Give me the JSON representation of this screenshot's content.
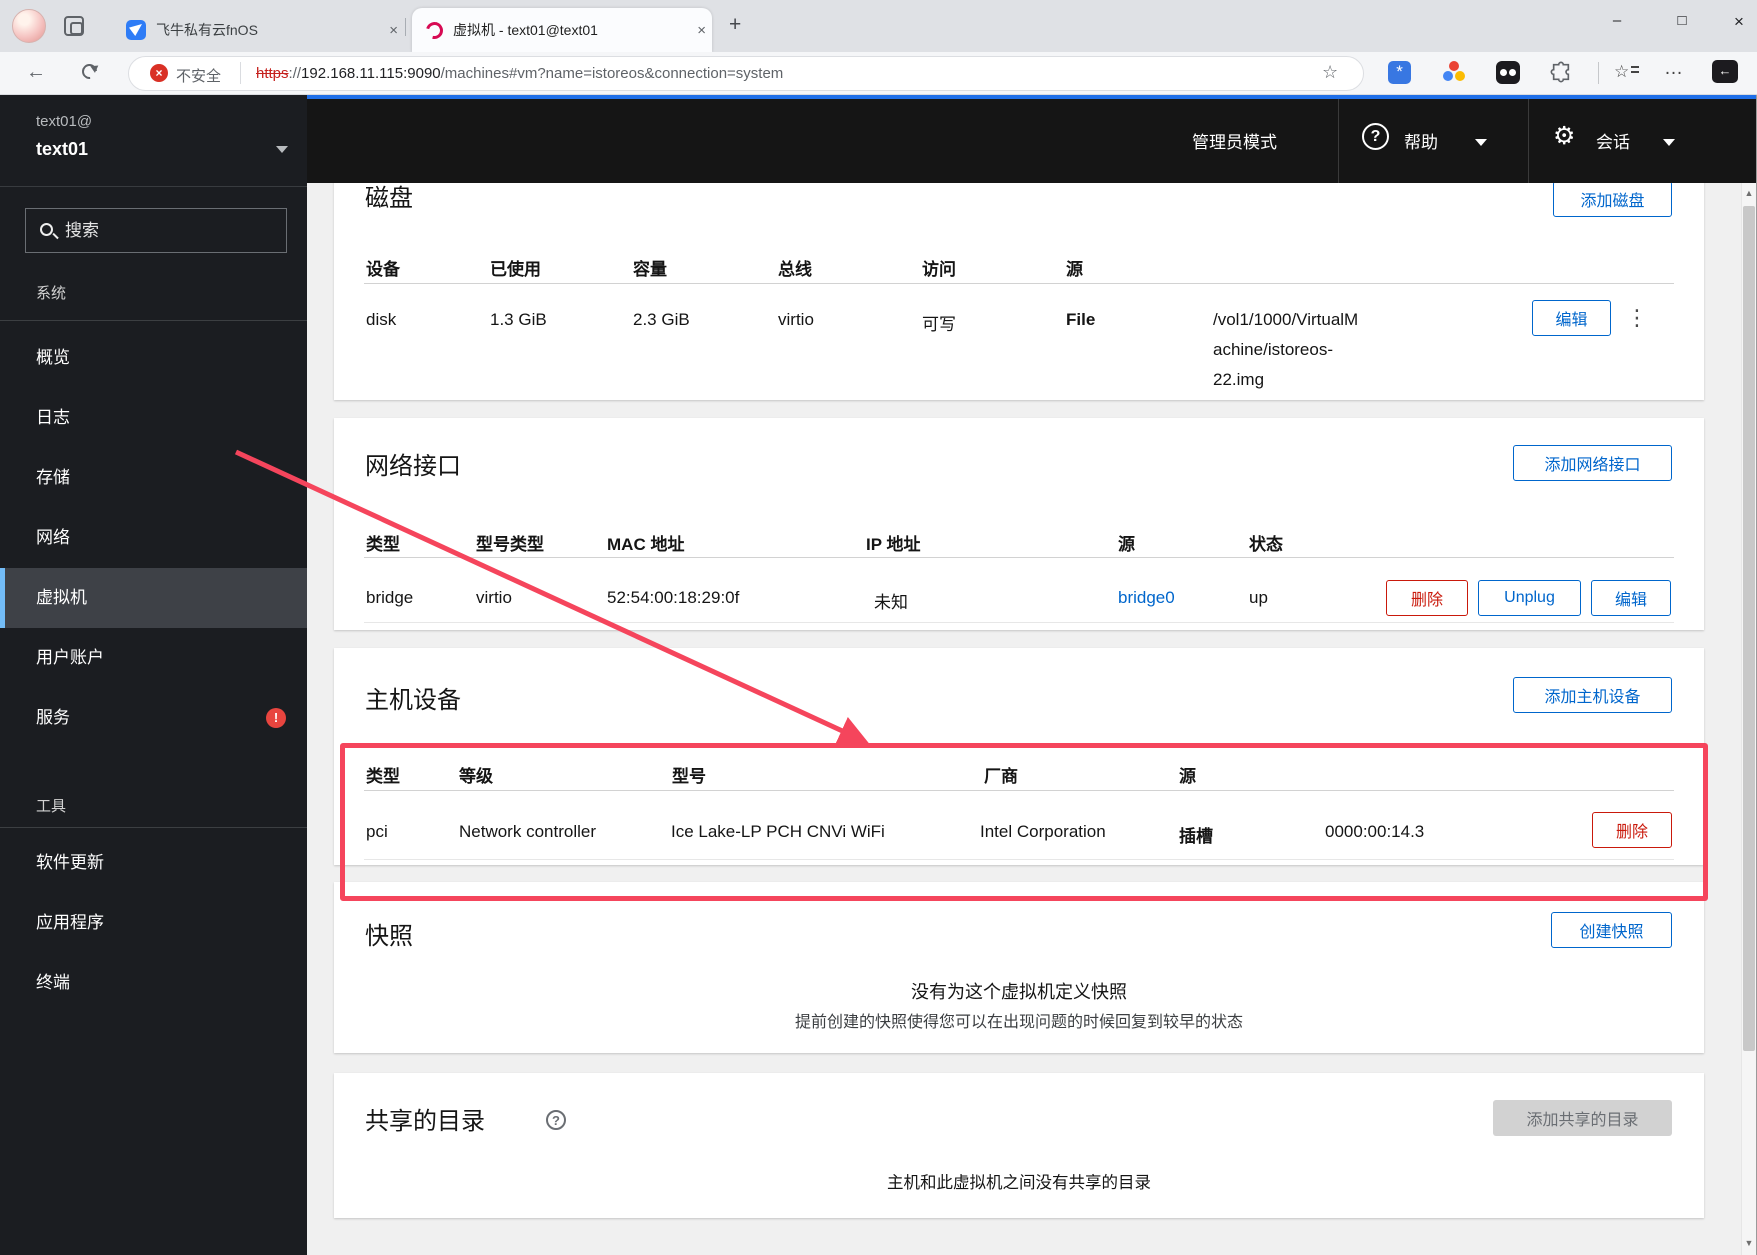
{
  "browser": {
    "tabs": [
      {
        "title": "飞牛私有云fnOS"
      },
      {
        "title": "虚拟机 - text01@text01"
      }
    ],
    "url": {
      "warning": "不安全",
      "scheme": "https",
      "sep": "://",
      "host": "192.168.11.115:9090",
      "path": "/machines#vm?name=istoreos&connection=system"
    }
  },
  "masthead": {
    "admin_mode": "管理员模式",
    "help": "帮助",
    "session": "会话"
  },
  "sidebar": {
    "user": "text01@",
    "host": "text01",
    "search_placeholder": "搜索",
    "section_system": "系统",
    "section_tools": "工具",
    "items": [
      "概览",
      "日志",
      "存储",
      "网络",
      "虚拟机",
      "用户账户",
      "服务",
      "软件更新",
      "应用程序",
      "终端"
    ]
  },
  "disks": {
    "title": "磁盘",
    "add_label": "添加磁盘",
    "headers": [
      "设备",
      "已使用",
      "容量",
      "总线",
      "访问",
      "源"
    ],
    "row": {
      "device": "disk",
      "used": "1.3 GiB",
      "capacity": "2.3 GiB",
      "bus": "virtio",
      "access": "可写",
      "source_label": "File",
      "path_line1": "/vol1/1000/VirtualM",
      "path_line2": "achine/istoreos-",
      "path_line3": "22.img",
      "edit_label": "编辑"
    }
  },
  "network": {
    "title": "网络接口",
    "add_label": "添加网络接口",
    "headers": [
      "类型",
      "型号类型",
      "MAC 地址",
      "IP 地址",
      "源",
      "状态"
    ],
    "row": {
      "type": "bridge",
      "model": "virtio",
      "mac": "52:54:00:18:29:0f",
      "ip": "未知",
      "source": "bridge0",
      "state": "up",
      "delete_label": "删除",
      "unplug_label": "Unplug",
      "edit_label": "编辑"
    }
  },
  "hostdevs": {
    "title": "主机设备",
    "add_label": "添加主机设备",
    "headers": [
      "类型",
      "等级",
      "型号",
      "厂商",
      "源"
    ],
    "row": {
      "type": "pci",
      "class": "Network controller",
      "model": "Ice Lake-LP PCH CNVi WiFi",
      "vendor": "Intel Corporation",
      "source_label": "插槽",
      "source_value": "0000:00:14.3",
      "delete_label": "删除"
    }
  },
  "snapshots": {
    "title": "快照",
    "create_label": "创建快照",
    "empty_title": "没有为这个虚拟机定义快照",
    "empty_hint": "提前创建的快照使得您可以在出现问题的时候回复到较早的状态"
  },
  "shared": {
    "title": "共享的目录",
    "add_label": "添加共享的目录",
    "empty": "主机和此虚拟机之间没有共享的目录"
  },
  "icons": {
    "back": "←",
    "star": "☆",
    "more": "…",
    "plus": "+",
    "minimize": "–",
    "maximize": "□",
    "close": "×",
    "x": "×",
    "kebab": "⋮",
    "scroll_up": "▲",
    "scroll_down": "▼",
    "exclamation": "!",
    "question": "?",
    "gear": "⚙",
    "asterisk": "*",
    "left_arrow": "←"
  },
  "colors": {
    "accent": "#0066cc",
    "danger": "#c9190b",
    "annotation": "#f5455c",
    "selected_border": "#73bcf7"
  }
}
